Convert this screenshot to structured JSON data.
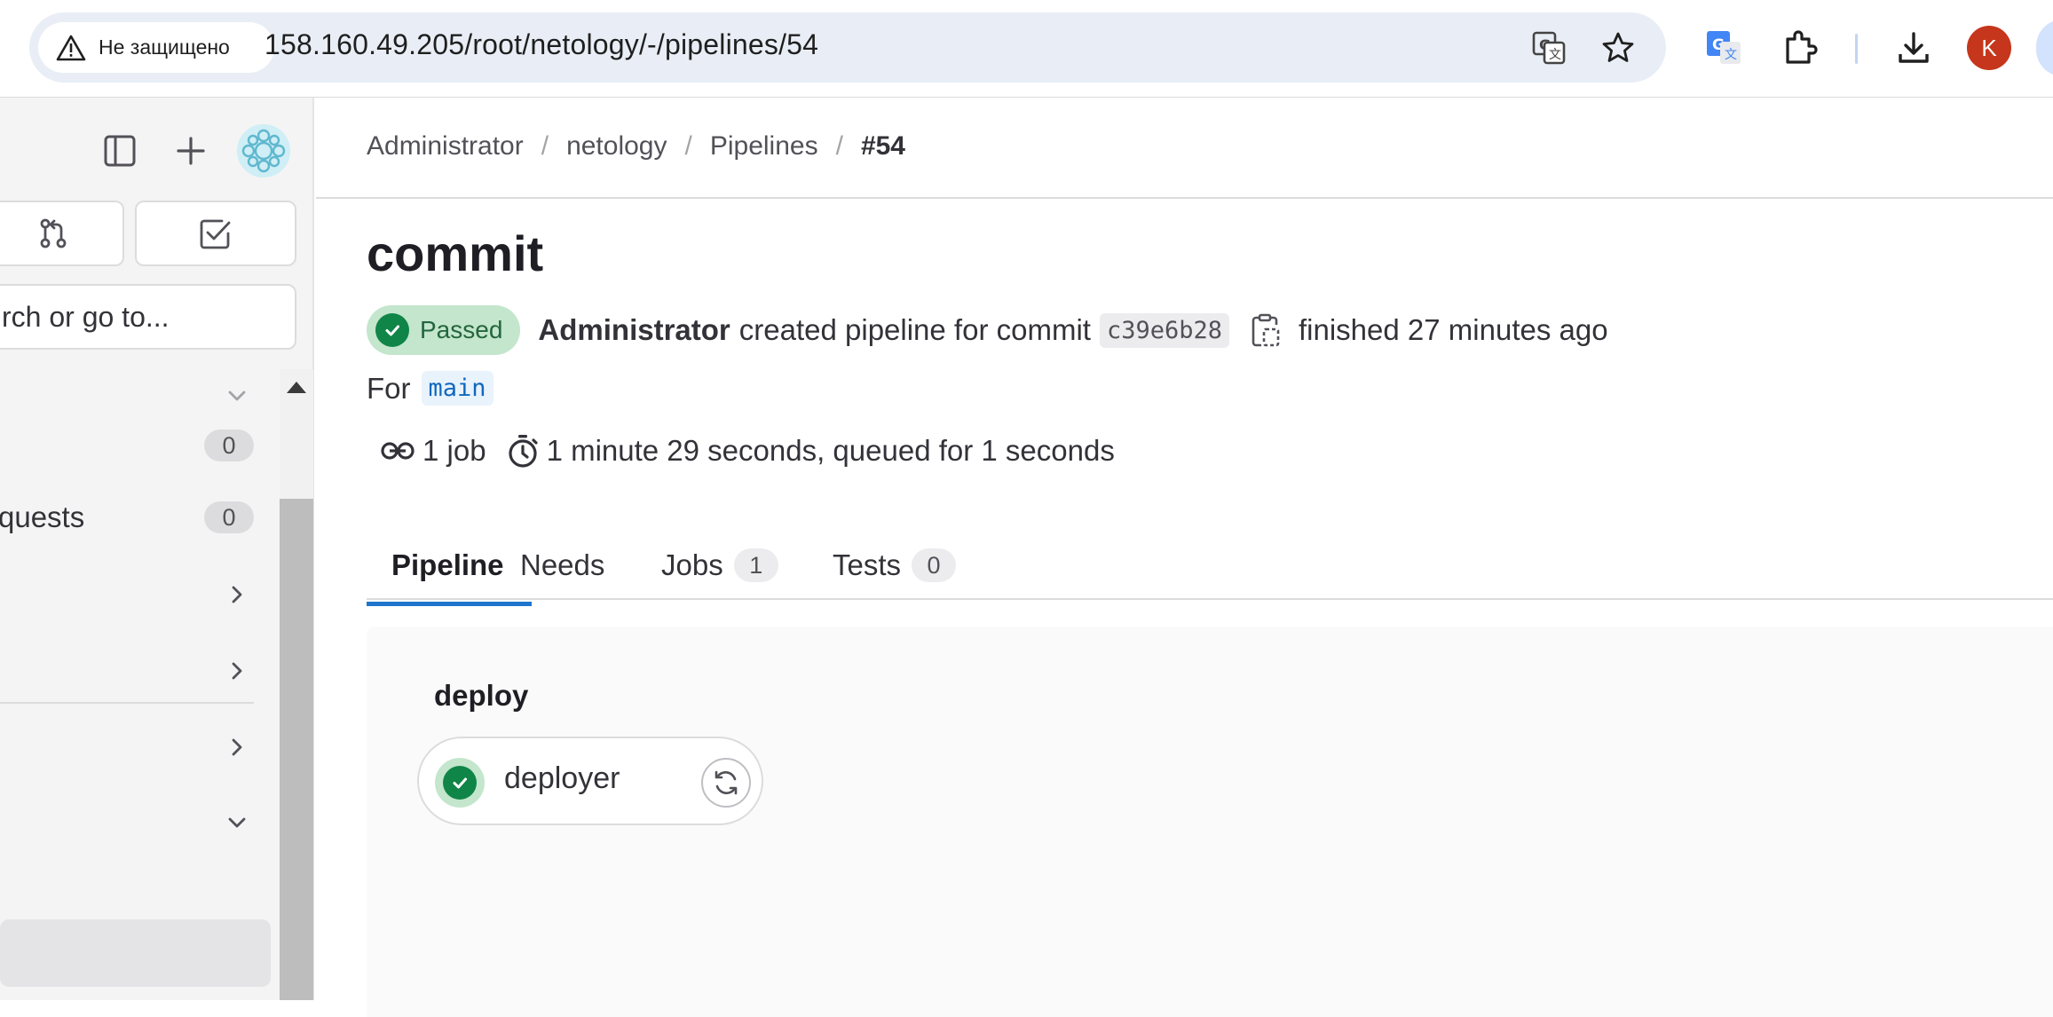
{
  "browser": {
    "security_label": "Не защищено",
    "url": "158.160.49.205/root/netology/-/pipelines/54",
    "profile_initial": "K"
  },
  "sidebar": {
    "search_placeholder": "rch or go to...",
    "items": [
      {
        "label": "",
        "type": "collapse"
      },
      {
        "label": "",
        "badge": "0"
      },
      {
        "label": "quests",
        "badge": "0"
      },
      {
        "label": "",
        "type": "expand"
      },
      {
        "label": "",
        "type": "expand"
      },
      {
        "label": "",
        "type": "expand"
      },
      {
        "label": "",
        "type": "collapse"
      }
    ]
  },
  "breadcrumb": {
    "items": [
      "Administrator",
      "netology",
      "Pipelines"
    ],
    "current": "#54"
  },
  "page": {
    "title": "commit",
    "status": "Passed",
    "author": "Administrator",
    "action_text": "created pipeline for commit",
    "commit_sha": "c39e6b28",
    "finished_text": "finished 27 minutes ago",
    "for_label": "For",
    "branch": "main",
    "jobs_count_text": "1 job",
    "duration_text": "1 minute 29 seconds, queued for 1 seconds"
  },
  "tabs": [
    {
      "label": "Pipeline",
      "active": true
    },
    {
      "label": "Needs"
    },
    {
      "label": "Jobs",
      "count": "1"
    },
    {
      "label": "Tests",
      "count": "0"
    }
  ],
  "graph": {
    "stage": "deploy",
    "job": {
      "name": "deployer",
      "status": "passed"
    }
  },
  "colors": {
    "success": "#108548",
    "success_bg": "#c3e6cd",
    "active_tab": "#1f75cb",
    "branch": "#1068bf"
  }
}
